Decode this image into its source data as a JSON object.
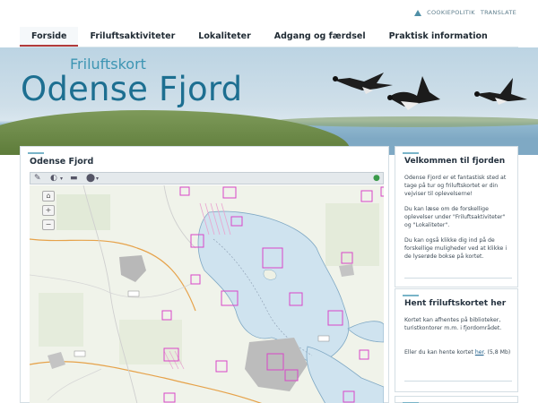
{
  "utility": {
    "cookie": "COOKIEPOLITIK",
    "translate": "TRANSLATE"
  },
  "nav": [
    {
      "label": "Forside"
    },
    {
      "label": "Friluftsaktiviteter"
    },
    {
      "label": "Lokaliteter"
    },
    {
      "label": "Adgang og færdsel"
    },
    {
      "label": "Praktisk information"
    }
  ],
  "hero": {
    "subtitle": "Friluftskort",
    "title": "Odense Fjord"
  },
  "main": {
    "title": "Odense Fjord"
  },
  "welcome": {
    "title": "Velkommen til fjorden",
    "p1": "Odense Fjord er et fantastisk sted at tage på tur og friluftskortet er din vejviser til oplevelserne!",
    "p2": "Du kan læse om de forskellige oplevelser under \"Friluftsaktiviteter\" og \"Lokaliteter\".",
    "p3": "Du kan også klikke dig ind på de forskellige muligheder ved at klikke i de lyserøde bokse på kortet."
  },
  "download": {
    "title": "Hent friluftskortet her",
    "p1": "Kortet kan afhentes på biblioteker, turistkontorer m.m. i fjordområdet.",
    "p2_before": "Eller du kan hente kortet ",
    "p2_link": "her",
    "p2_after": ". (5,8 Mb)"
  },
  "colors": {
    "accent": "#1d6f91",
    "nav_active": "#b23b3b",
    "poi_box": "#d946c8"
  }
}
